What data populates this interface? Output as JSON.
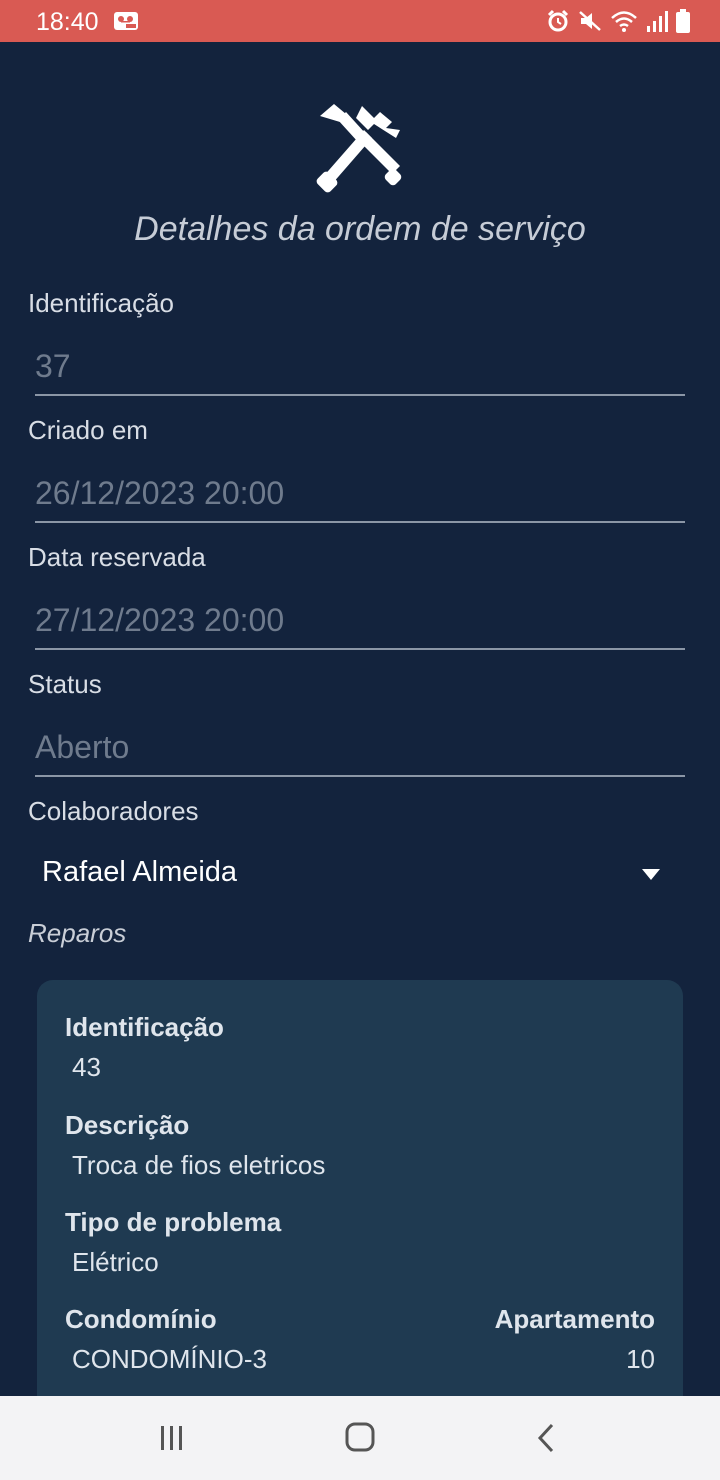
{
  "status_bar": {
    "time": "18:40",
    "left_icon": "voicemail-icon",
    "right_icons": [
      "alarm-icon",
      "mute-icon",
      "wifi-icon",
      "signal-icon",
      "battery-icon"
    ]
  },
  "header": {
    "icon": "tools-icon",
    "title": "Detalhes da ordem de serviço"
  },
  "fields": [
    {
      "label": "Identificação",
      "value": "37"
    },
    {
      "label": "Criado em",
      "value": "26/12/2023 20:00"
    },
    {
      "label": "Data reservada",
      "value": "27/12/2023 20:00"
    },
    {
      "label": "Status",
      "value": "Aberto"
    },
    {
      "label": "Colaboradores"
    }
  ],
  "collaborators": {
    "selected": "Rafael Almeida",
    "icon": "dropdown-arrow-icon"
  },
  "repairs": {
    "section_label": "Reparos",
    "items": [
      {
        "id_label": "Identificação",
        "id": "43",
        "description_label": "Descrição",
        "description": "Troca de fios eletricos",
        "problem_type_label": "Tipo de problema",
        "problem_type": "Elétrico",
        "condominium_label": "Condomínio",
        "condominium": "CONDOMÍNIO-3",
        "apartment_label": "Apartamento",
        "apartment": "10"
      }
    ]
  },
  "nav_bar": {
    "icons": [
      "recent-apps-icon",
      "home-icon",
      "back-icon"
    ]
  },
  "colors": {
    "status_bar": "#d95a53",
    "background": "#13233d",
    "card": "#1f3a51",
    "nav_bar": "#f3f3f5"
  }
}
